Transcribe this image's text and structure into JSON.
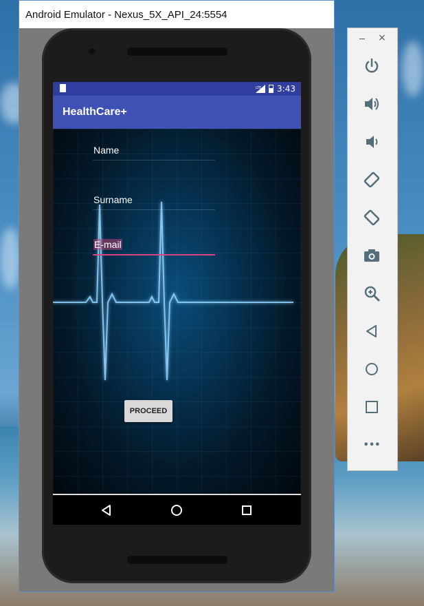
{
  "window": {
    "title": "Android Emulator - Nexus_5X_API_24:5554"
  },
  "status_bar": {
    "time": "3:43",
    "network": "LTE"
  },
  "app_bar": {
    "title": "HealthCare+"
  },
  "form": {
    "fields": [
      {
        "label": "Name"
      },
      {
        "label": "Surname"
      },
      {
        "label": "E-mail"
      }
    ],
    "proceed_label": "PROCEED"
  },
  "nav_bar": {
    "buttons": [
      "back-icon",
      "home-icon",
      "recents-icon"
    ]
  },
  "toolbar": {
    "window_buttons": {
      "minimize": "–",
      "close": "×"
    },
    "items": [
      "power-icon",
      "volume-up-icon",
      "volume-down-icon",
      "rotate-left-icon",
      "rotate-right-icon",
      "camera-icon",
      "zoom-icon",
      "back-icon",
      "home-icon",
      "overview-icon",
      "more-icon"
    ],
    "more_label": "•••"
  },
  "colors": {
    "status_bar": "#303f9f",
    "app_bar": "#3f51b5",
    "accent": "#d6457e",
    "toolbar_icon": "#546e7a"
  }
}
